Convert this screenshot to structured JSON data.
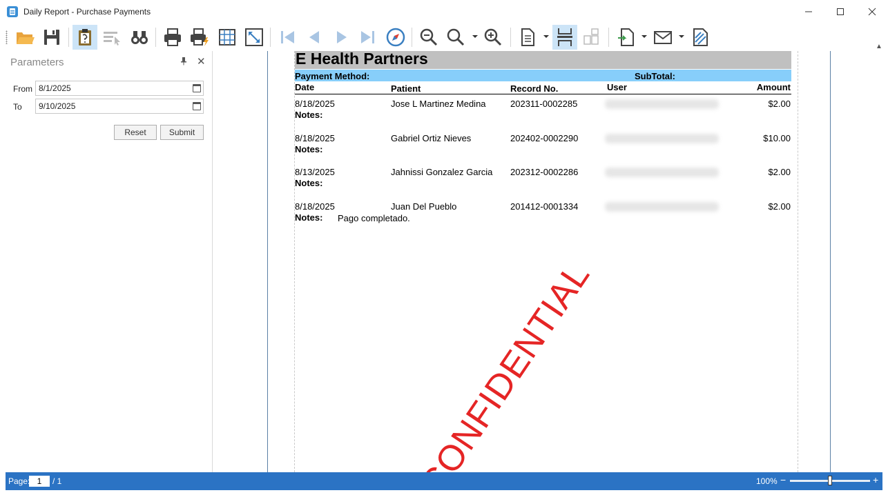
{
  "window": {
    "title": "Daily Report - Purchase Payments",
    "minimize_icon": "minimize-icon",
    "maximize_icon": "maximize-icon",
    "close_icon": "close-icon"
  },
  "toolbar": {
    "icons": [
      "open-folder-icon",
      "save-icon",
      "parameters-clipboard-icon",
      "select-arrow-icon",
      "binoculars-find-icon",
      "print-icon",
      "quick-print-icon",
      "page-grid-icon",
      "fit-page-icon",
      "first-page-icon",
      "previous-page-icon",
      "next-page-icon",
      "last-page-icon",
      "navigate-compass-icon",
      "zoom-out-icon",
      "zoom-icon",
      "zoom-in-icon",
      "page-setup-icon",
      "continuous-view-icon",
      "multiple-pages-icon",
      "export-icon",
      "email-icon",
      "watermark-icon"
    ]
  },
  "parameters": {
    "title": "Parameters",
    "from_label": "From",
    "from_value": "8/1/2025",
    "to_label": "To",
    "to_value": "9/10/2025",
    "reset_label": "Reset",
    "submit_label": "Submit"
  },
  "report": {
    "title": "E Health Partners",
    "payment_method_label": "Payment Method:",
    "subtotal_label": "SubTotal:",
    "columns": {
      "date": "Date",
      "patient": "Patient",
      "record": "Record No.",
      "user": "User",
      "amount": "Amount"
    },
    "notes_label": "Notes:",
    "rows": [
      {
        "date": "8/18/2025",
        "patient": "Jose L Martinez Medina",
        "record": "202311-0002285",
        "amount": "$2.00",
        "notes": ""
      },
      {
        "date": "8/18/2025",
        "patient": "Gabriel Ortiz Nieves",
        "record": "202402-0002290",
        "amount": "$10.00",
        "notes": ""
      },
      {
        "date": "8/13/2025",
        "patient": "Jahnissi Gonzalez Garcia",
        "record": "202312-0002286",
        "amount": "$2.00",
        "notes": ""
      },
      {
        "date": "8/18/2025",
        "patient": "Juan Del Pueblo",
        "record": "201412-0001334",
        "amount": "$2.00",
        "notes": "Pago completado."
      }
    ],
    "watermark": "CONFIDENTIAL"
  },
  "status": {
    "page_label": "Page:",
    "page_current": "1",
    "page_total": "/ 1",
    "zoom": "100%",
    "zoom_level": 0.5
  },
  "colors": {
    "accent": "#2b73c4",
    "group_bar": "#87cefa",
    "title_bar": "#c0c0c0",
    "watermark": "#e52525"
  }
}
